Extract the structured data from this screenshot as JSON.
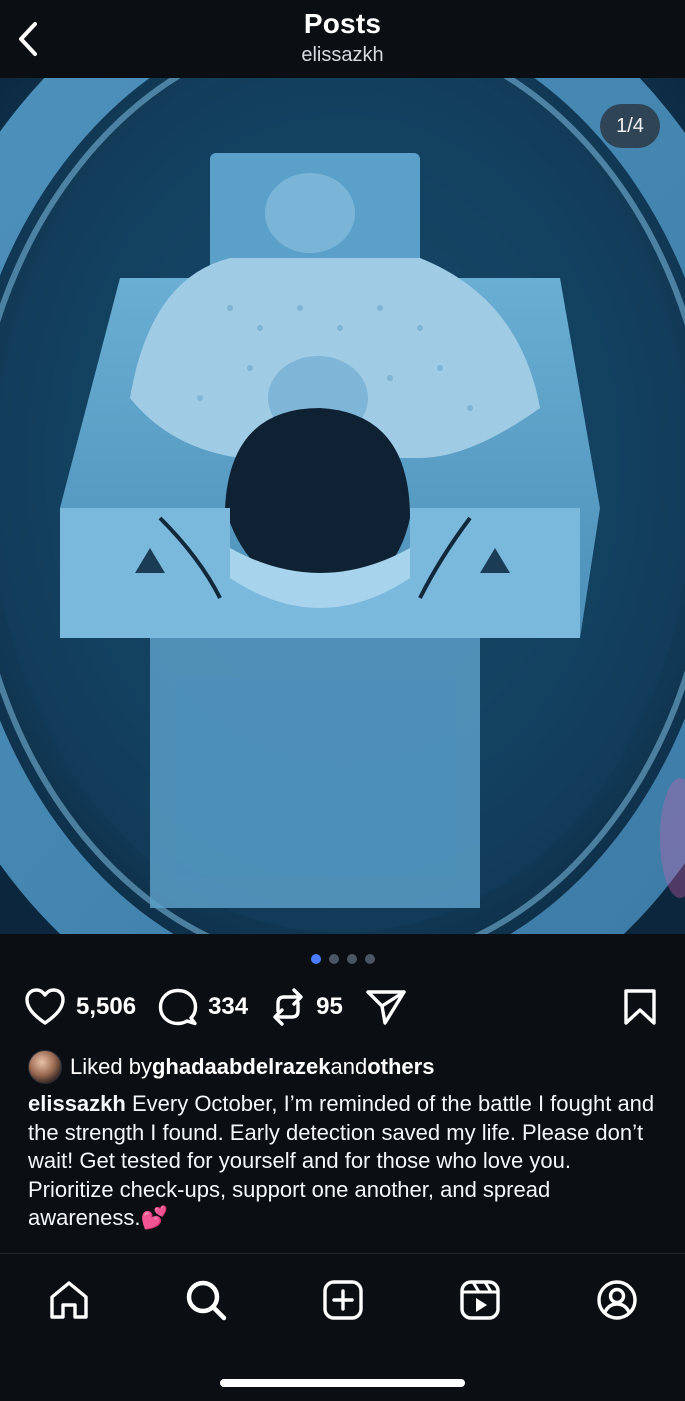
{
  "header": {
    "title": "Posts",
    "username": "elissazkh"
  },
  "media": {
    "counter": "1/4",
    "total_slides": 4,
    "active_slide": 1
  },
  "actions": {
    "likes": "5,506",
    "comments": "334",
    "reposts": "95"
  },
  "liked_by": {
    "prefix": "Liked by ",
    "user": "ghadaabdelrazek",
    "middle": " and ",
    "others": "others"
  },
  "caption": {
    "user": "elissazkh",
    "text": "Every October, I’m reminded of the battle I fought and the strength I found. Early detection saved my life. Please don’t wait! Get tested for yourself and for those who love you. Prioritize check-ups, support one another, and spread awareness.",
    "emoji": "💕"
  },
  "icons": {
    "back": "chevron-left-icon",
    "like": "heart-icon",
    "comment": "comment-icon",
    "repost": "repost-icon",
    "share": "send-icon",
    "save": "bookmark-icon",
    "home": "home-icon",
    "search": "search-icon",
    "create": "plus-square-icon",
    "reels": "reels-icon",
    "profile": "profile-icon"
  },
  "colors": {
    "background": "#0b0f14",
    "active_dot": "#4a7dff",
    "inactive_dot": "#4b5563",
    "image_tint": "#2f7aa8"
  }
}
